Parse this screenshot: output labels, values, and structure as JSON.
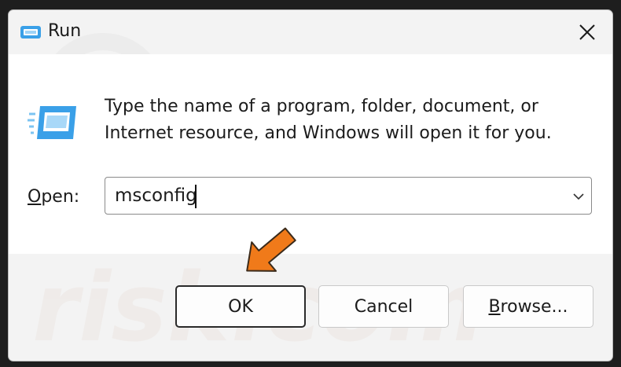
{
  "window": {
    "title": "Run"
  },
  "main": {
    "description_line1": "Type the name of a program, folder, document, or",
    "description_line2": "Internet resource, and Windows will open it for you.",
    "open_label_accel": "O",
    "open_label_rest": "pen:",
    "open_value": "msconfig"
  },
  "buttons": {
    "ok": "OK",
    "cancel": "Cancel",
    "browse_accel": "B",
    "browse_rest": "rowse..."
  },
  "watermark": {
    "text": "risk.com"
  },
  "colors": {
    "accent_icon": "#3aa0e8",
    "annotation_arrow": "#f07a1a",
    "window_bg": "#f3f3f3",
    "client_bg": "#ffffff"
  },
  "icons": {
    "app": "run-icon",
    "close": "close-icon",
    "dropdown": "chevron-down-icon",
    "annotation": "arrow-pointer-icon"
  }
}
